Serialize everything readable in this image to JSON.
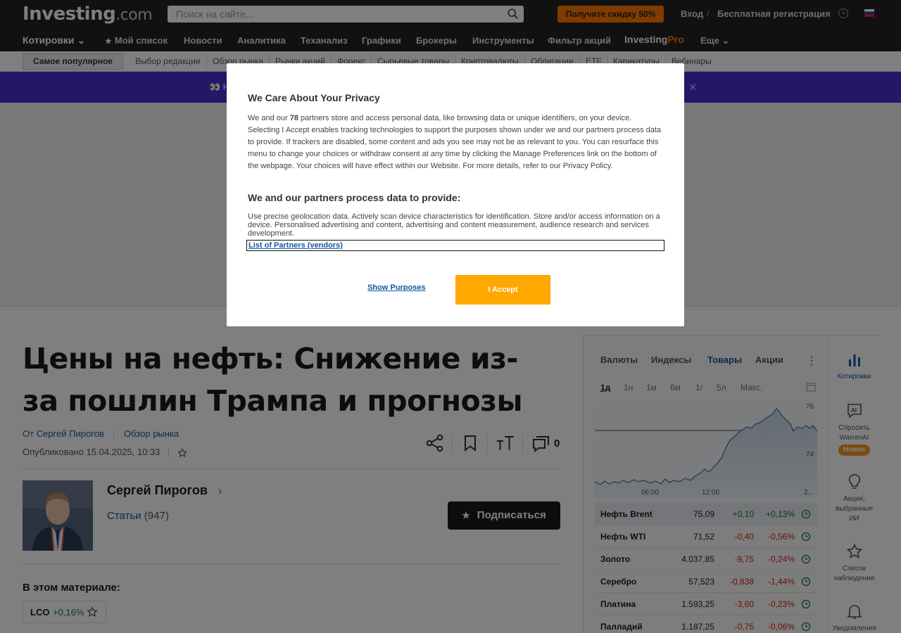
{
  "header": {
    "logo_main": "Investing",
    "logo_suffix": ".com",
    "search_placeholder": "Поиск на сайте...",
    "promo_label": "Получите скидку 50%",
    "login_label": "Вход",
    "separator": "/",
    "register_label": "Бесплатная регистрация"
  },
  "mainnav": {
    "quotes": "Котировки",
    "items": [
      "Мой список",
      "Новости",
      "Аналитика",
      "Теханализ",
      "Графики",
      "Брокеры",
      "Инструменты",
      "Фильтр акций"
    ],
    "pro_brand": "Investing",
    "pro_suffix": "Pro",
    "more": "Еще"
  },
  "subnav": {
    "popular": "Самое популярное",
    "items": [
      "Выбор редакции",
      "Обзор рынка",
      "Рынки акций",
      "Форекс",
      "Сырьевые товары",
      "Криптовалюты",
      "Облигации",
      "ETF",
      "Карикатуры",
      "Вебинары"
    ]
  },
  "banner": {
    "emoji": "👀 Н",
    "close": "×"
  },
  "article": {
    "headline": "Цены на нефть: Снижение из-за пошлин Трампа и прогнозы",
    "by_prefix": "От",
    "author": "Сергей Пирогов",
    "category": "Обзор рынка",
    "published": "Опубликовано 15.04.2025, 10:33",
    "comment_count": "0",
    "author_name": "Сергей Пирогов",
    "articles_label": "Статьи",
    "articles_count": "(947)",
    "subscribe_label": "Подписаться",
    "in_material_label": "В этом материале:",
    "instrument": {
      "symbol": "LCO",
      "change": "+0,16%"
    }
  },
  "widget": {
    "tabs": [
      "Валюты",
      "Индексы",
      "Товары",
      "Акции"
    ],
    "active_tab": "Товары",
    "ranges": [
      "1д",
      "1н",
      "1м",
      "6м",
      "1г",
      "5л",
      "Макс."
    ],
    "active_range": "1д",
    "chart_axis": {
      "y_top": "76",
      "y_mid": "74",
      "x_labels": [
        "06:00",
        "12:00",
        "2..."
      ]
    },
    "rows": [
      {
        "name": "Нефть Brent",
        "price": "75,09",
        "change": "+0,10",
        "pct": "+0,13%",
        "dir": "up"
      },
      {
        "name": "Нефть WTI",
        "price": "71,52",
        "change": "-0,40",
        "pct": "-0,56%",
        "dir": "down"
      },
      {
        "name": "Золото",
        "price": "4.037,85",
        "change": "-9,75",
        "pct": "-0,24%",
        "dir": "down"
      },
      {
        "name": "Серебро",
        "price": "57,523",
        "change": "-0,838",
        "pct": "-1,44%",
        "dir": "down"
      },
      {
        "name": "Платина",
        "price": "1.593,25",
        "change": "-3,60",
        "pct": "-0,23%",
        "dir": "down"
      },
      {
        "name": "Палладий",
        "price": "1.187,25",
        "change": "-0,75",
        "pct": "-0,06%",
        "dir": "down"
      }
    ],
    "sidebar": {
      "quotes": "Котировки",
      "warren_1": "Спросить",
      "warren_2": "WarrenAI",
      "new_badge": "Новое",
      "ai_picks_1": "Акции,",
      "ai_picks_2": "выбранные",
      "ai_picks_3": "ИИ",
      "watchlist_1": "Список",
      "watchlist_2": "наблюдения",
      "alerts": "Уведомления"
    }
  },
  "modal": {
    "title": "We Care About Your Privacy",
    "text_prefix": "We and our ",
    "partners_count": "78",
    "text_body": " partners store and access personal data, like browsing data or unique identifiers, on your device. Selecting I Accept enables tracking technologies to support the purposes shown under we and our partners process data to provide. If trackers are disabled, some content and ads you see may not be as relevant to you. You can resurface this menu to change your choices or withdraw consent at any time by clicking the Manage Preferences link on the bottom of the webpage. Your choices will have effect within our Website. For more details, refer to our Privacy Policy.",
    "subtitle": "We and our partners process data to provide:",
    "purposes": "Use precise geolocation data. Actively scan device characteristics for identification. Store and/or access information on a device. Personalised advertising and content, advertising and content measurement, audience research and services development.",
    "partners_link": "List of Partners (vendors)",
    "show_purposes": "Show Purposes",
    "accept": "I Accept"
  },
  "colors": {
    "accent_orange": "#ff7700",
    "accept_orange": "#ffa800",
    "link_blue": "#1256a0",
    "up_green": "#0a7d3b",
    "down_red": "#d91e18",
    "banner_purple": "#4a2fd0"
  }
}
